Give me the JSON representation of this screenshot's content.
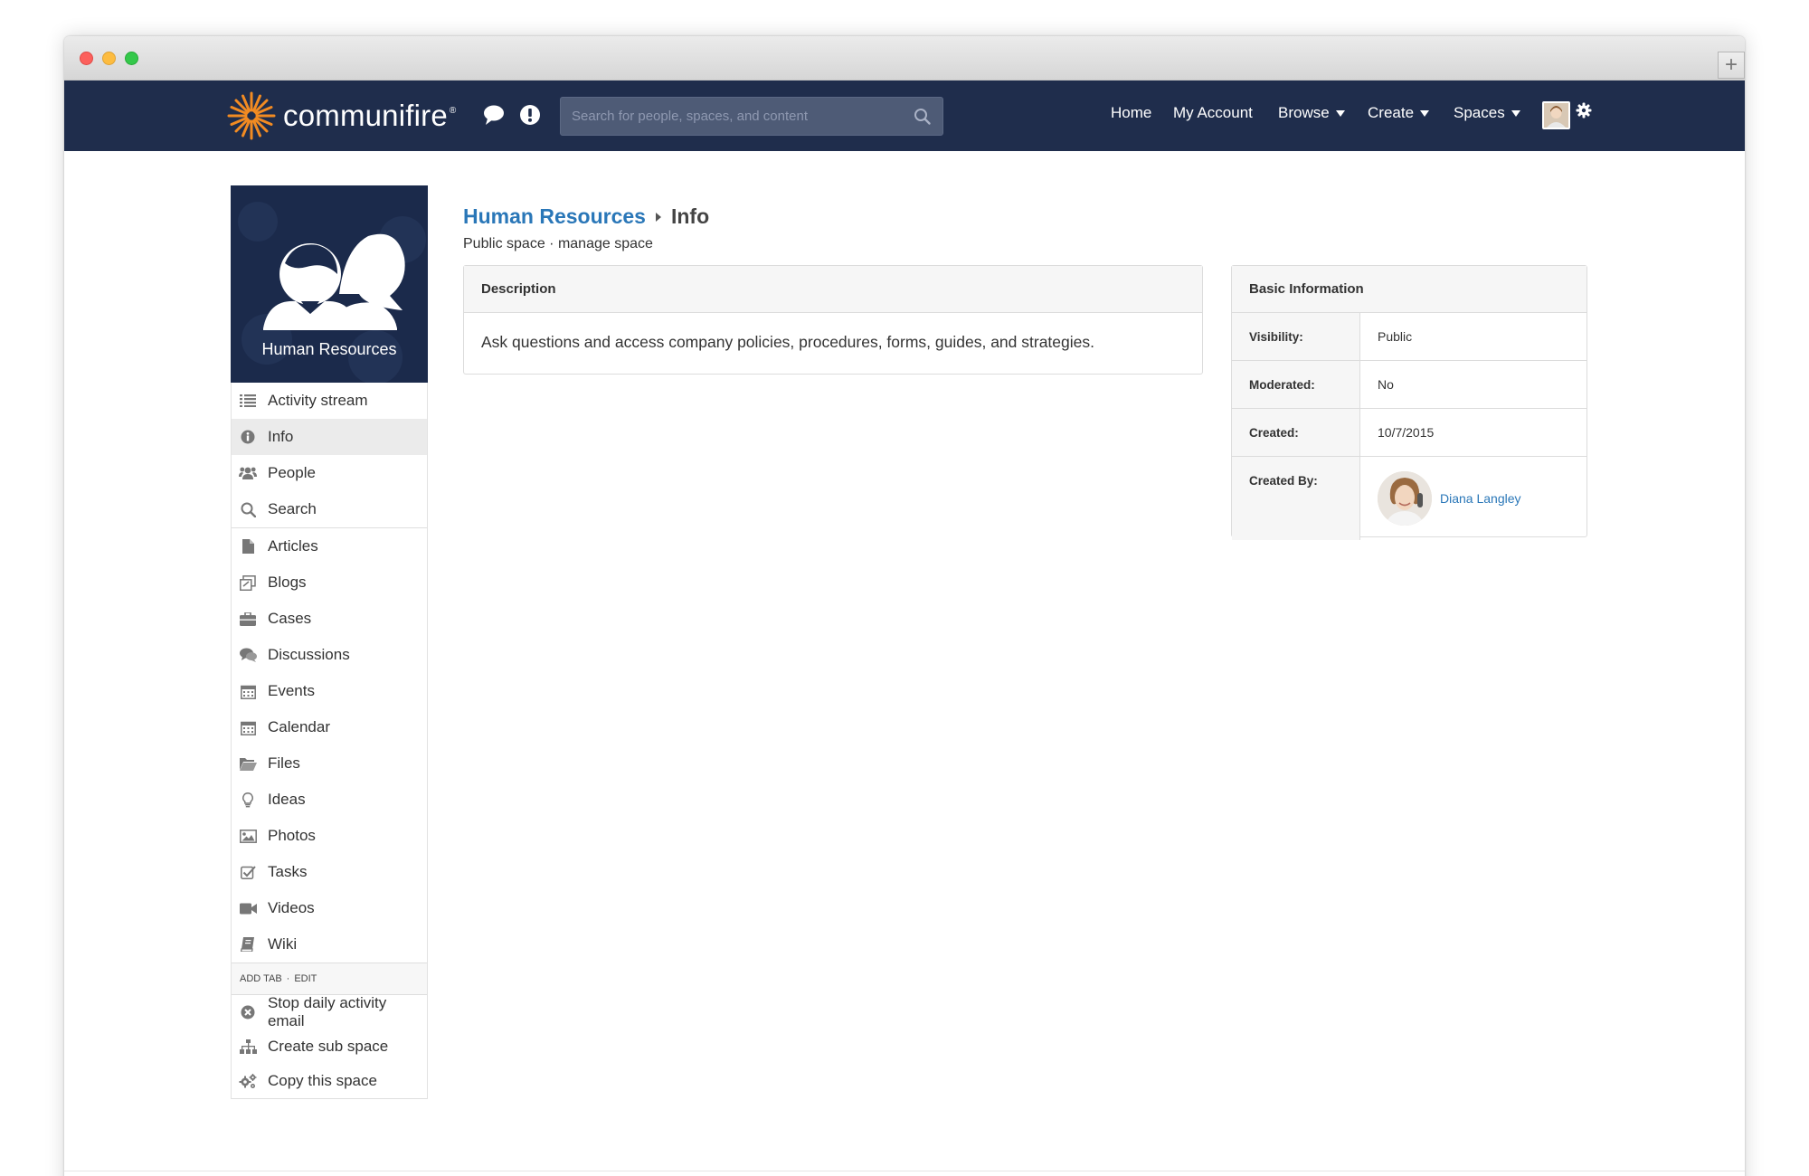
{
  "brand": {
    "name": "communifire",
    "reg": "®"
  },
  "colors": {
    "navbar": "#1f2d4c",
    "link": "#2a77b8",
    "logo_orange": "#f28b22",
    "space_tile": "#1b2a4b"
  },
  "navbar": {
    "icons": [
      "chat-bubble-icon",
      "alert-exclamation-icon"
    ],
    "search": {
      "placeholder": "Search for people, spaces, and content",
      "value": ""
    },
    "links": {
      "home": "Home",
      "my_account": "My Account",
      "browse": "Browse",
      "create": "Create",
      "spaces": "Spaces"
    }
  },
  "space": {
    "name": "Human Resources"
  },
  "sidebar": {
    "nav": [
      {
        "label": "Activity stream",
        "icon": "list-icon"
      },
      {
        "label": "Info",
        "icon": "info-circle-icon",
        "active": true
      },
      {
        "label": "People",
        "icon": "users-icon"
      },
      {
        "label": "Search",
        "icon": "search-icon"
      }
    ],
    "content": [
      {
        "label": "Articles",
        "icon": "document-icon"
      },
      {
        "label": "Blogs",
        "icon": "blog-icon"
      },
      {
        "label": "Cases",
        "icon": "briefcase-icon"
      },
      {
        "label": "Discussions",
        "icon": "comments-icon"
      },
      {
        "label": "Events",
        "icon": "calendar-icon"
      },
      {
        "label": "Calendar",
        "icon": "calendar-icon"
      },
      {
        "label": "Files",
        "icon": "folder-open-icon"
      },
      {
        "label": "Ideas",
        "icon": "lightbulb-icon"
      },
      {
        "label": "Photos",
        "icon": "picture-icon"
      },
      {
        "label": "Tasks",
        "icon": "checkbox-icon"
      },
      {
        "label": "Videos",
        "icon": "video-camera-icon"
      },
      {
        "label": "Wiki",
        "icon": "book-icon"
      }
    ],
    "meta": {
      "add_tab": "ADD TAB",
      "sep": "·",
      "edit": "EDIT"
    },
    "actions": [
      {
        "label": "Stop daily activity email",
        "icon": "close-circle-icon"
      },
      {
        "label": "Create sub space",
        "icon": "sitemap-icon"
      },
      {
        "label": "Copy this space",
        "icon": "gears-icon"
      }
    ]
  },
  "page": {
    "breadcrumb_parent": "Human Resources",
    "breadcrumb_current": "Info",
    "subtitle_type": "Public space",
    "subtitle_sep": "·",
    "subtitle_link": "manage space"
  },
  "description": {
    "heading": "Description",
    "text": "Ask questions and access company policies, procedures, forms, guides, and strategies."
  },
  "basic_info": {
    "heading": "Basic Information",
    "rows": [
      {
        "key": "Visibility:",
        "value": "Public"
      },
      {
        "key": "Moderated:",
        "value": "No"
      },
      {
        "key": "Created:",
        "value": "10/7/2015"
      },
      {
        "key": "Created By:",
        "value": "Diana Langley"
      }
    ]
  }
}
